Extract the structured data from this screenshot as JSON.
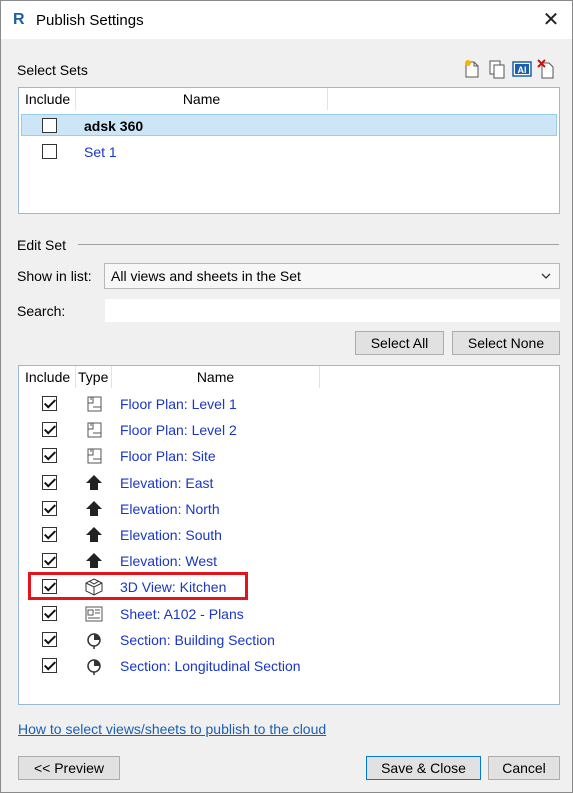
{
  "window": {
    "title": "Publish Settings",
    "app_icon": "R"
  },
  "select_sets": {
    "section_label": "Select Sets",
    "columns": {
      "include": "Include",
      "name": "Name"
    },
    "rows": [
      {
        "name": "adsk 360",
        "checked": false,
        "selected": true
      },
      {
        "name": "Set 1",
        "checked": false,
        "selected": false
      }
    ]
  },
  "edit_set": {
    "section_label": "Edit Set",
    "show_in_list_label": "Show in list:",
    "show_in_list_value": "All views and sheets in the Set",
    "search_label": "Search:",
    "search_value": "",
    "select_all_label": "Select All",
    "select_none_label": "Select None"
  },
  "views": {
    "columns": {
      "include": "Include",
      "type": "Type",
      "name": "Name"
    },
    "rows": [
      {
        "name": "Floor Plan: Level 1",
        "type": "floor-plan",
        "checked": true
      },
      {
        "name": "Floor Plan: Level 2",
        "type": "floor-plan",
        "checked": true
      },
      {
        "name": "Floor Plan: Site",
        "type": "floor-plan",
        "checked": true
      },
      {
        "name": "Elevation: East",
        "type": "elevation",
        "checked": true
      },
      {
        "name": "Elevation: North",
        "type": "elevation",
        "checked": true
      },
      {
        "name": "Elevation: South",
        "type": "elevation",
        "checked": true
      },
      {
        "name": "Elevation: West",
        "type": "elevation",
        "checked": true
      },
      {
        "name": "3D View: Kitchen",
        "type": "3d-view",
        "checked": true,
        "highlighted": true
      },
      {
        "name": "Sheet: A102 - Plans",
        "type": "sheet",
        "checked": true
      },
      {
        "name": "Section: Building Section",
        "type": "section",
        "checked": true
      },
      {
        "name": "Section: Longitudinal Section",
        "type": "section",
        "checked": true
      }
    ]
  },
  "footer": {
    "help_link": "How to select views/sheets to publish to the cloud",
    "preview_label": "<< Preview",
    "save_close_label": "Save & Close",
    "cancel_label": "Cancel"
  },
  "colors": {
    "link": "#1a36c6",
    "highlight": "#e3141c",
    "selection": "#cde6f7"
  }
}
